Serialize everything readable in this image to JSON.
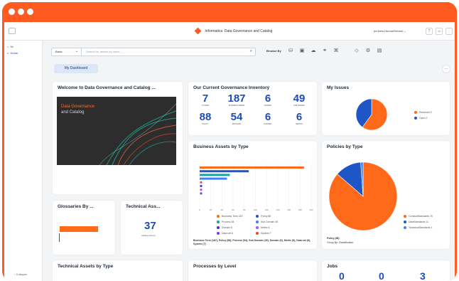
{
  "app": {
    "brand": "Informatica",
    "title": "Data Governance and Catalog",
    "org": "prt-beta-HumanService"
  },
  "colors": {
    "frame": "#ff5a1f",
    "accent": "#1e4bb5",
    "orange": "#ff6a1a",
    "blue": "#1e56c8"
  },
  "sidebar": {
    "items": [
      {
        "label": "Nt",
        "icon": "home-icon"
      },
      {
        "label": "Home",
        "icon": "search-icon"
      }
    ],
    "collapse_label": "Collapse"
  },
  "search": {
    "mode": "Basic",
    "placeholder": "Search for assets by name..."
  },
  "browse": {
    "label": "Browse By",
    "icons": [
      "database-icon",
      "lock-icon",
      "cloud-icon",
      "link-icon",
      "network-icon",
      "tag-icon",
      "settings-icon",
      "document-icon"
    ]
  },
  "tab": {
    "label": "My Dashboard"
  },
  "welcome": {
    "title": "Welcome to Data Governance and Catalog ...",
    "banner_line1": "Data Governance",
    "banner_line2": "and Catalog"
  },
  "inventory": {
    "title": "Our Current Governance Inventory",
    "stats": [
      {
        "value": "7",
        "label": "system"
      },
      {
        "value": "187",
        "label": "business terms"
      },
      {
        "value": "6",
        "label": "domain"
      },
      {
        "value": "49",
        "label": "sub domain"
      },
      {
        "value": "88",
        "label": "policy"
      },
      {
        "value": "54",
        "label": "process"
      },
      {
        "value": "6",
        "label": "dataset"
      },
      {
        "value": "6",
        "label": "metric"
      }
    ]
  },
  "my_issues": {
    "title": "My Issues",
    "legend": [
      {
        "label": "Resolved  3",
        "color": "#ff6a1a"
      },
      {
        "label": "Open  2",
        "color": "#1e56c8"
      }
    ]
  },
  "business_assets": {
    "title": "Business Assets by Type",
    "axis_ticks": [
      "0",
      "20",
      "40",
      "60",
      "80",
      "100",
      "120",
      "140",
      "160",
      "180",
      "200"
    ],
    "legend": [
      {
        "label": "Business Term  187",
        "color": "#ff6a1a"
      },
      {
        "label": "Policy  88",
        "color": "#1e56c8"
      },
      {
        "label": "Process  54",
        "color": "#1aa0a0"
      },
      {
        "label": "Sub Domain  49",
        "color": "#3b82f6"
      },
      {
        "label": "Domain  6",
        "color": "#4338ca"
      },
      {
        "label": "Metric  6",
        "color": "#a855f7"
      },
      {
        "label": "Data set  6",
        "color": "#7c3aed"
      },
      {
        "label": "System  7",
        "color": "#ef4444"
      }
    ],
    "footnote": "Business Term (187), Policy (88), Process (54), Sub Domain (49), Domain (6), Metric (6), Data set (6), System (7)"
  },
  "policies": {
    "title": "Policies by Type",
    "legend": [
      {
        "label": "ConductStandards  76",
        "color": "#ff6a1a"
      },
      {
        "label": "DataStandards  11",
        "color": "#1e56c8"
      },
      {
        "label": "TechnicalStandards  1",
        "color": "#3b82f6"
      }
    ],
    "footnote_1": "Policy (88)",
    "footnote_2": "Group By: Classification"
  },
  "glossaries": {
    "title": "Glossaries By ..."
  },
  "technical_assets_count": {
    "title": "Technical Ass...",
    "value": "37",
    "label": "catalog source"
  },
  "technical_assets_type": {
    "title": "Technical Assets by Type"
  },
  "processes": {
    "title": "Processes by Level"
  },
  "jobs": {
    "title": "Jobs",
    "values": [
      "0",
      "0",
      "3"
    ]
  },
  "chart_data": [
    {
      "type": "pie",
      "title": "My Issues",
      "categories": [
        "Resolved",
        "Open"
      ],
      "values": [
        3,
        2
      ]
    },
    {
      "type": "bar",
      "title": "Business Assets by Type",
      "orientation": "horizontal",
      "categories": [
        "Business Term",
        "Policy",
        "Process",
        "Sub Domain",
        "System",
        "Domain",
        "Metric",
        "Data set"
      ],
      "values": [
        187,
        88,
        54,
        49,
        7,
        6,
        6,
        6
      ],
      "xlim": [
        0,
        200
      ],
      "grid": true,
      "legend": "bottom"
    },
    {
      "type": "pie",
      "title": "Policies by Type",
      "categories": [
        "ConductStandards",
        "DataStandards",
        "TechnicalStandards"
      ],
      "values": [
        76,
        11,
        1
      ]
    }
  ]
}
